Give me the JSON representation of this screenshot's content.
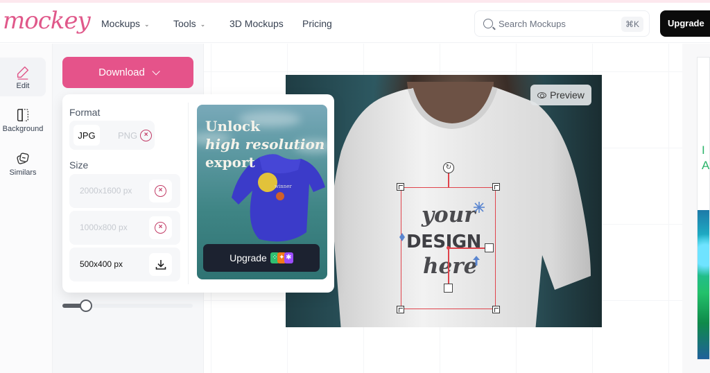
{
  "header": {
    "logo": "mockey",
    "nav": [
      {
        "label": "Mockups",
        "dropdown": true
      },
      {
        "label": "Tools",
        "dropdown": true
      },
      {
        "label": "3D Mockups",
        "dropdown": false
      },
      {
        "label": "Pricing",
        "dropdown": false
      }
    ],
    "search": {
      "placeholder": "Search Mockups",
      "shortcut": "⌘K"
    },
    "upgrade_label": "Upgrade"
  },
  "rail": {
    "items": [
      {
        "label": "Edit",
        "icon": "pencil-icon",
        "active": true
      },
      {
        "label": "Background",
        "icon": "background-icon",
        "active": false
      },
      {
        "label": "Similars",
        "icon": "similars-icon",
        "active": false
      }
    ]
  },
  "panel": {
    "download_label": "Download",
    "slider_value": 0.18
  },
  "download_menu": {
    "format_label": "Format",
    "formats": [
      {
        "label": "JPG",
        "selected": true,
        "locked": false
      },
      {
        "label": "PNG",
        "selected": false,
        "locked": true
      }
    ],
    "size_label": "Size",
    "sizes": [
      {
        "label": "2000x1600 px",
        "locked": true
      },
      {
        "label": "1000x800 px",
        "locked": true
      },
      {
        "label": "500x400 px",
        "locked": false
      }
    ],
    "promo": {
      "line1": "Unlock",
      "line2": "high resolution",
      "line3": "export",
      "upgrade_label": "Upgrade",
      "badge_colors": [
        "#2fbf71",
        "#f07a1a",
        "#9b4dff"
      ]
    }
  },
  "canvas": {
    "preview_label": "Preview",
    "design_text": {
      "line1": "your",
      "line2": "DESIGN",
      "line3": "here"
    },
    "selection_color": "#e0434b"
  },
  "ad": {
    "text_line1": "I",
    "text_line2": "AI"
  },
  "colors": {
    "brand": "#e5538a",
    "dark": "#0b0b0b"
  }
}
